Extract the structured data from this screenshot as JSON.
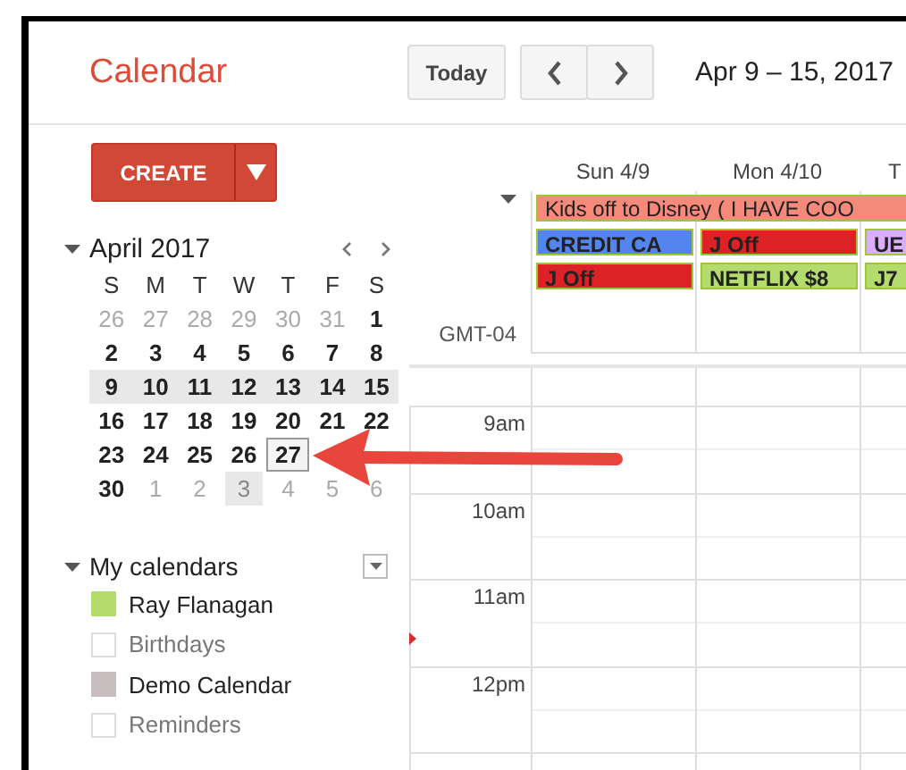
{
  "header": {
    "app_title": "Calendar",
    "today_button": "Today",
    "date_range": "Apr 9 – 15, 2017"
  },
  "sidebar": {
    "create_button": "CREATE",
    "mini_calendar": {
      "month": "April 2017",
      "weekdays": [
        "S",
        "M",
        "T",
        "W",
        "T",
        "F",
        "S"
      ],
      "weeks": [
        {
          "selected": false,
          "days": [
            {
              "d": "26",
              "muted": true,
              "today": false
            },
            {
              "d": "27",
              "muted": true,
              "today": false
            },
            {
              "d": "28",
              "muted": true,
              "today": false
            },
            {
              "d": "29",
              "muted": true,
              "today": false
            },
            {
              "d": "30",
              "muted": true,
              "today": false
            },
            {
              "d": "31",
              "muted": true,
              "today": false
            },
            {
              "d": "1",
              "muted": false,
              "today": false
            }
          ]
        },
        {
          "selected": false,
          "days": [
            {
              "d": "2",
              "muted": false,
              "today": false
            },
            {
              "d": "3",
              "muted": false,
              "today": false
            },
            {
              "d": "4",
              "muted": false,
              "today": false
            },
            {
              "d": "5",
              "muted": false,
              "today": false
            },
            {
              "d": "6",
              "muted": false,
              "today": false
            },
            {
              "d": "7",
              "muted": false,
              "today": false
            },
            {
              "d": "8",
              "muted": false,
              "today": false
            }
          ]
        },
        {
          "selected": true,
          "days": [
            {
              "d": "9",
              "muted": false,
              "today": false
            },
            {
              "d": "10",
              "muted": false,
              "today": false
            },
            {
              "d": "11",
              "muted": false,
              "today": false
            },
            {
              "d": "12",
              "muted": false,
              "today": false
            },
            {
              "d": "13",
              "muted": false,
              "today": false
            },
            {
              "d": "14",
              "muted": false,
              "today": false
            },
            {
              "d": "15",
              "muted": false,
              "today": false
            }
          ]
        },
        {
          "selected": false,
          "days": [
            {
              "d": "16",
              "muted": false,
              "today": false
            },
            {
              "d": "17",
              "muted": false,
              "today": false
            },
            {
              "d": "18",
              "muted": false,
              "today": false
            },
            {
              "d": "19",
              "muted": false,
              "today": false
            },
            {
              "d": "20",
              "muted": false,
              "today": false
            },
            {
              "d": "21",
              "muted": false,
              "today": false
            },
            {
              "d": "22",
              "muted": false,
              "today": false
            }
          ]
        },
        {
          "selected": false,
          "days": [
            {
              "d": "23",
              "muted": false,
              "today": false
            },
            {
              "d": "24",
              "muted": false,
              "today": false
            },
            {
              "d": "25",
              "muted": false,
              "today": false
            },
            {
              "d": "26",
              "muted": false,
              "today": false
            },
            {
              "d": "27",
              "muted": false,
              "today": true
            }
          ]
        },
        {
          "selected": false,
          "days": [
            {
              "d": "30",
              "muted": false,
              "today": false
            },
            {
              "d": "1",
              "muted": true,
              "today": false
            },
            {
              "d": "2",
              "muted": true,
              "today": false
            },
            {
              "d": "3",
              "muted": true,
              "today": false,
              "hovered": true
            },
            {
              "d": "4",
              "muted": true,
              "today": false
            },
            {
              "d": "5",
              "muted": true,
              "today": false
            },
            {
              "d": "6",
              "muted": true,
              "today": false
            }
          ]
        }
      ]
    },
    "my_calendars": {
      "title": "My calendars",
      "expanded": true,
      "items": [
        {
          "name": "Ray Flanagan",
          "checked": true,
          "color": "#b3dc6c"
        },
        {
          "name": "Birthdays",
          "checked": false
        },
        {
          "name": "Demo Calendar",
          "checked": true,
          "color": "#cabdbf"
        },
        {
          "name": "Reminders",
          "checked": false
        }
      ]
    }
  },
  "week": {
    "days": [
      {
        "label": "Sun 4/9"
      },
      {
        "label": "Mon 4/10"
      },
      {
        "label": "T"
      }
    ],
    "all_day_rows": [
      [
        {
          "kind": "span",
          "text": "Kids off to Disney ( I HAVE COO",
          "color": "#f58a7b"
        }
      ],
      [
        {
          "kind": "day",
          "text": "CREDIT CA",
          "color": "#5484ed"
        },
        {
          "kind": "day",
          "text": "J Off",
          "color": "#dc2127"
        },
        {
          "kind": "day",
          "text": "UE",
          "color": "#dbadff"
        }
      ],
      [
        {
          "kind": "day",
          "text": "J Off",
          "color": "#dc2127"
        },
        {
          "kind": "day",
          "text": "NETFLIX $8",
          "color": "#b3dc6c"
        },
        {
          "kind": "day",
          "text": "J7",
          "color": "#b3dc6c"
        }
      ]
    ],
    "timezone": "GMT-04",
    "hours": [
      "9am",
      "10am",
      "11am",
      "12pm"
    ]
  }
}
